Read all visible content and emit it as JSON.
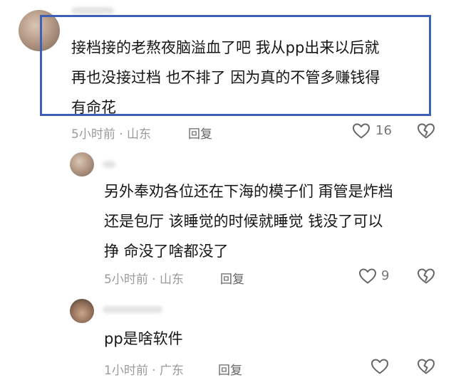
{
  "comments": [
    {
      "lines": [
        "接档接的老熬夜脑溢血了吧  我从pp出来以后就",
        "再也没接过档  也不排了  因为真的不管多赚钱得",
        "有命花"
      ],
      "time": "5小时前 · 山东",
      "reply_label": "回复",
      "likes": "16",
      "highlighted": true
    },
    {
      "lines": [
        "另外奉劝各位还在下海的模子们  甭管是炸档",
        "还是包厅  该睡觉的时候就睡觉  钱没了可以",
        "挣  命没了啥都没了"
      ],
      "time": "5小时前 · 山东",
      "reply_label": "回复",
      "likes": "9"
    },
    {
      "lines": [
        "pp是啥软件"
      ],
      "time": "1小时前 · 广东",
      "reply_label": "回复",
      "likes": ""
    }
  ],
  "colors": {
    "highlight_border": "#3d5fb5",
    "meta_text": "#9a9a9a",
    "icon_stroke": "#666666"
  },
  "icons": [
    "avatar",
    "heart-icon",
    "dislike-heart-icon"
  ]
}
